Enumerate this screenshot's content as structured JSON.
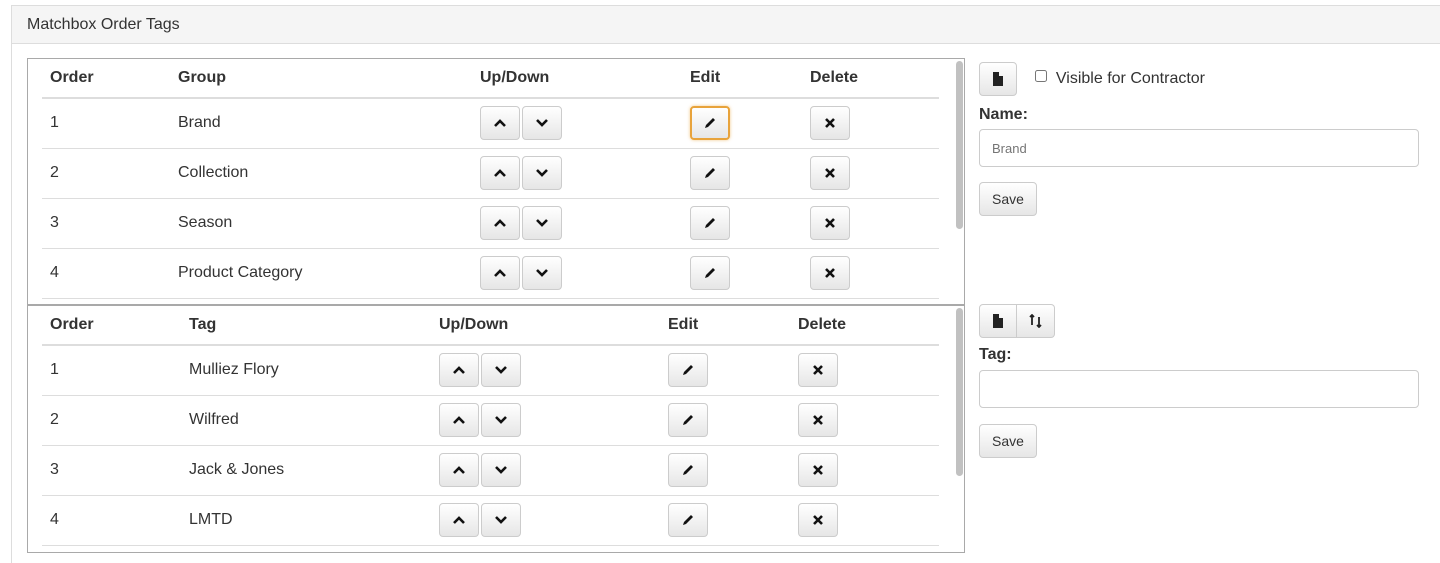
{
  "panel": {
    "title": "Matchbox Order Tags"
  },
  "groups": {
    "headers": {
      "order": "Order",
      "name": "Group",
      "updown": "Up/Down",
      "edit": "Edit",
      "delete": "Delete"
    },
    "rows": [
      {
        "order": "1",
        "name": "Brand"
      },
      {
        "order": "2",
        "name": "Collection"
      },
      {
        "order": "3",
        "name": "Season"
      },
      {
        "order": "4",
        "name": "Product Category"
      }
    ]
  },
  "tags": {
    "headers": {
      "order": "Order",
      "name": "Tag",
      "updown": "Up/Down",
      "edit": "Edit",
      "delete": "Delete"
    },
    "rows": [
      {
        "order": "1",
        "name": "Mulliez Flory"
      },
      {
        "order": "2",
        "name": "Wilfred"
      },
      {
        "order": "3",
        "name": "Jack & Jones"
      },
      {
        "order": "4",
        "name": "LMTD"
      }
    ]
  },
  "group_form": {
    "visible_label": "Visible for Contractor",
    "name_label": "Name:",
    "name_placeholder": "Brand",
    "save_label": "Save"
  },
  "tag_form": {
    "tag_label": "Tag:",
    "tag_placeholder": "",
    "save_label": "Save"
  },
  "colors": {
    "focus": "#e8a33b",
    "border": "#dddddd"
  }
}
